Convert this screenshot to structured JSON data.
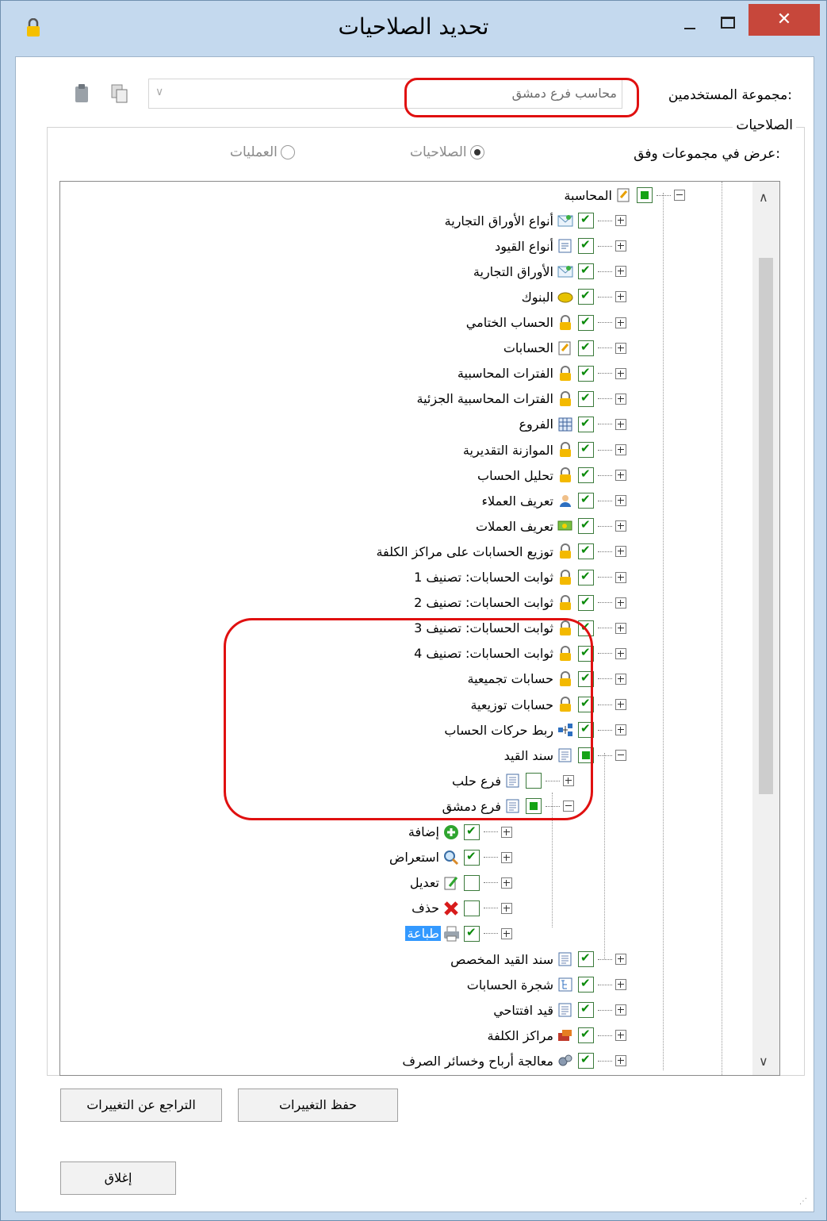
{
  "window": {
    "title": "تحديد الصلاحيات",
    "close_glyph": "✕"
  },
  "user_group": {
    "label": "مجموعة المستخدمين:",
    "value": "محاسب فرع دمشق"
  },
  "permissions_group": {
    "title": "الصلاحيات",
    "view_by_label": "عرض في مجموعات وفق:",
    "radio_permissions": "الصلاحيات",
    "radio_operations": "العمليات"
  },
  "tree": [
    {
      "label": "المحاسبة",
      "level": 0,
      "state": "partial",
      "expanded": true,
      "icon": "accounting-icon"
    },
    {
      "label": "أنواع الأوراق التجارية",
      "level": 1,
      "state": "checked",
      "icon": "envelope-icon"
    },
    {
      "label": "أنواع القيود",
      "level": 1,
      "state": "checked",
      "icon": "journal-types-icon"
    },
    {
      "label": "الأوراق التجارية",
      "level": 1,
      "state": "checked",
      "icon": "envelope-icon"
    },
    {
      "label": "البنوك",
      "level": 1,
      "state": "checked",
      "icon": "bank-icon"
    },
    {
      "label": "الحساب الختامي",
      "level": 1,
      "state": "checked",
      "icon": "lock-icon"
    },
    {
      "label": "الحسابات",
      "level": 1,
      "state": "checked",
      "icon": "accounts-icon"
    },
    {
      "label": "الفترات المحاسبية",
      "level": 1,
      "state": "checked",
      "icon": "lock-icon"
    },
    {
      "label": "الفترات المحاسبية الجزئية",
      "level": 1,
      "state": "checked",
      "icon": "lock-icon"
    },
    {
      "label": "الفروع",
      "level": 1,
      "state": "checked",
      "icon": "branches-icon"
    },
    {
      "label": "الموازنة التقديرية",
      "level": 1,
      "state": "checked",
      "icon": "lock-icon"
    },
    {
      "label": "تحليل الحساب",
      "level": 1,
      "state": "checked",
      "icon": "lock-icon"
    },
    {
      "label": "تعريف العملاء",
      "level": 1,
      "state": "checked",
      "icon": "customer-icon"
    },
    {
      "label": "تعريف العملات",
      "level": 1,
      "state": "checked",
      "icon": "currency-icon"
    },
    {
      "label": "توزيع الحسابات على مراكز الكلفة",
      "level": 1,
      "state": "checked",
      "icon": "lock-icon"
    },
    {
      "label": "ثوابت الحسابات: تصنيف 1",
      "level": 1,
      "state": "checked",
      "icon": "lock-icon"
    },
    {
      "label": "ثوابت الحسابات: تصنيف 2",
      "level": 1,
      "state": "checked",
      "icon": "lock-icon"
    },
    {
      "label": "ثوابت الحسابات: تصنيف 3",
      "level": 1,
      "state": "checked",
      "icon": "lock-icon"
    },
    {
      "label": "ثوابت الحسابات: تصنيف 4",
      "level": 1,
      "state": "checked",
      "icon": "lock-icon"
    },
    {
      "label": "حسابات تجميعية",
      "level": 1,
      "state": "checked",
      "icon": "lock-icon"
    },
    {
      "label": "حسابات توزيعية",
      "level": 1,
      "state": "checked",
      "icon": "lock-icon"
    },
    {
      "label": "ربط حركات الحساب",
      "level": 1,
      "state": "checked",
      "icon": "link-icon"
    },
    {
      "label": "سند القيد",
      "level": 1,
      "state": "partial",
      "expanded": true,
      "icon": "document-icon"
    },
    {
      "label": "فرع حلب",
      "level": 2,
      "state": "unchecked",
      "icon": "document-icon"
    },
    {
      "label": "فرع دمشق",
      "level": 2,
      "state": "partial",
      "expanded": true,
      "icon": "document-icon"
    },
    {
      "label": "إضافة",
      "level": 3,
      "state": "checked",
      "icon": "add-icon"
    },
    {
      "label": "استعراض",
      "level": 3,
      "state": "checked",
      "icon": "magnifier-icon"
    },
    {
      "label": "تعديل",
      "level": 3,
      "state": "unchecked",
      "icon": "edit-icon"
    },
    {
      "label": "حذف",
      "level": 3,
      "state": "unchecked",
      "icon": "delete-icon"
    },
    {
      "label": "طباعة",
      "level": 3,
      "state": "checked",
      "icon": "printer-icon",
      "selected": true
    },
    {
      "label": "سند القيد المخصص",
      "level": 1,
      "state": "checked",
      "icon": "document-icon"
    },
    {
      "label": "شجرة الحسابات",
      "level": 1,
      "state": "checked",
      "icon": "tree-icon"
    },
    {
      "label": "قيد افتتاحي",
      "level": 1,
      "state": "checked",
      "icon": "document-icon"
    },
    {
      "label": "مراكز الكلفة",
      "level": 1,
      "state": "checked",
      "icon": "cost-center-icon"
    },
    {
      "label": "معالجة أرباح وخسائر الصرف",
      "level": 1,
      "state": "checked",
      "icon": "gears-icon"
    }
  ],
  "buttons": {
    "save": "حفظ التغييرات",
    "revert": "التراجع عن التغييرات",
    "close": "إغلاق"
  },
  "colors": {
    "highlight": "#e01010",
    "selection": "#3399ff",
    "check": "#0a8a0a"
  }
}
